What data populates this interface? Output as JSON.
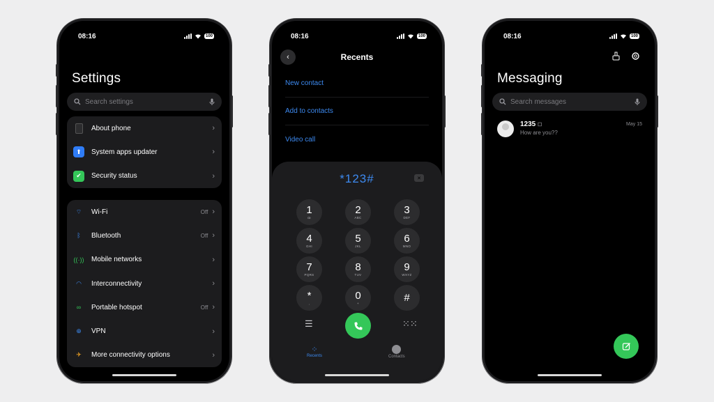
{
  "status": {
    "time": "08:16",
    "battery": "100"
  },
  "settings": {
    "title": "Settings",
    "search_placeholder": "Search settings",
    "group1": [
      {
        "label": "About phone",
        "icon": "phone-icon",
        "color": "#2c2c2e"
      },
      {
        "label": "System apps updater",
        "icon": "arrow-up-icon",
        "color": "#2f7cf6"
      },
      {
        "label": "Security status",
        "icon": "shield-check-icon",
        "color": "#34c759"
      }
    ],
    "group2": [
      {
        "label": "Wi-Fi",
        "value": "Off",
        "icon": "wifi-icon",
        "color": "#3d8af0"
      },
      {
        "label": "Bluetooth",
        "value": "Off",
        "icon": "bluetooth-icon",
        "color": "#3d8af0"
      },
      {
        "label": "Mobile networks",
        "value": "",
        "icon": "antenna-icon",
        "color": "#34c759"
      },
      {
        "label": "Interconnectivity",
        "value": "",
        "icon": "interconnect-icon",
        "color": "#3d8af0"
      },
      {
        "label": "Portable hotspot",
        "value": "Off",
        "icon": "hotspot-icon",
        "color": "#34c759"
      },
      {
        "label": "VPN",
        "value": "",
        "icon": "globe-icon",
        "color": "#3d8af0"
      },
      {
        "label": "More connectivity options",
        "value": "",
        "icon": "airplane-icon",
        "color": "#f5a623"
      }
    ]
  },
  "dialer": {
    "title": "Recents",
    "links": [
      "New contact",
      "Add to contacts",
      "Video call"
    ],
    "digits": "*123#",
    "keys": [
      {
        "d": "1",
        "s": "ꝏ"
      },
      {
        "d": "2",
        "s": "ABC"
      },
      {
        "d": "3",
        "s": "DEF"
      },
      {
        "d": "4",
        "s": "GHI"
      },
      {
        "d": "5",
        "s": "JKL"
      },
      {
        "d": "6",
        "s": "MNO"
      },
      {
        "d": "7",
        "s": "PQRS"
      },
      {
        "d": "8",
        "s": "TUV"
      },
      {
        "d": "9",
        "s": "WXYZ"
      },
      {
        "d": "*",
        "s": ","
      },
      {
        "d": "0",
        "s": "+"
      },
      {
        "d": "#",
        "s": ""
      }
    ],
    "tabs": {
      "recents": "Recents",
      "contacts": "Contacts"
    },
    "accent": "#3d8af0",
    "call_color": "#34c759"
  },
  "messaging": {
    "title": "Messaging",
    "search_placeholder": "Search messages",
    "conversations": [
      {
        "name": "1235",
        "preview": "How are you??",
        "date": "May 15"
      }
    ]
  }
}
